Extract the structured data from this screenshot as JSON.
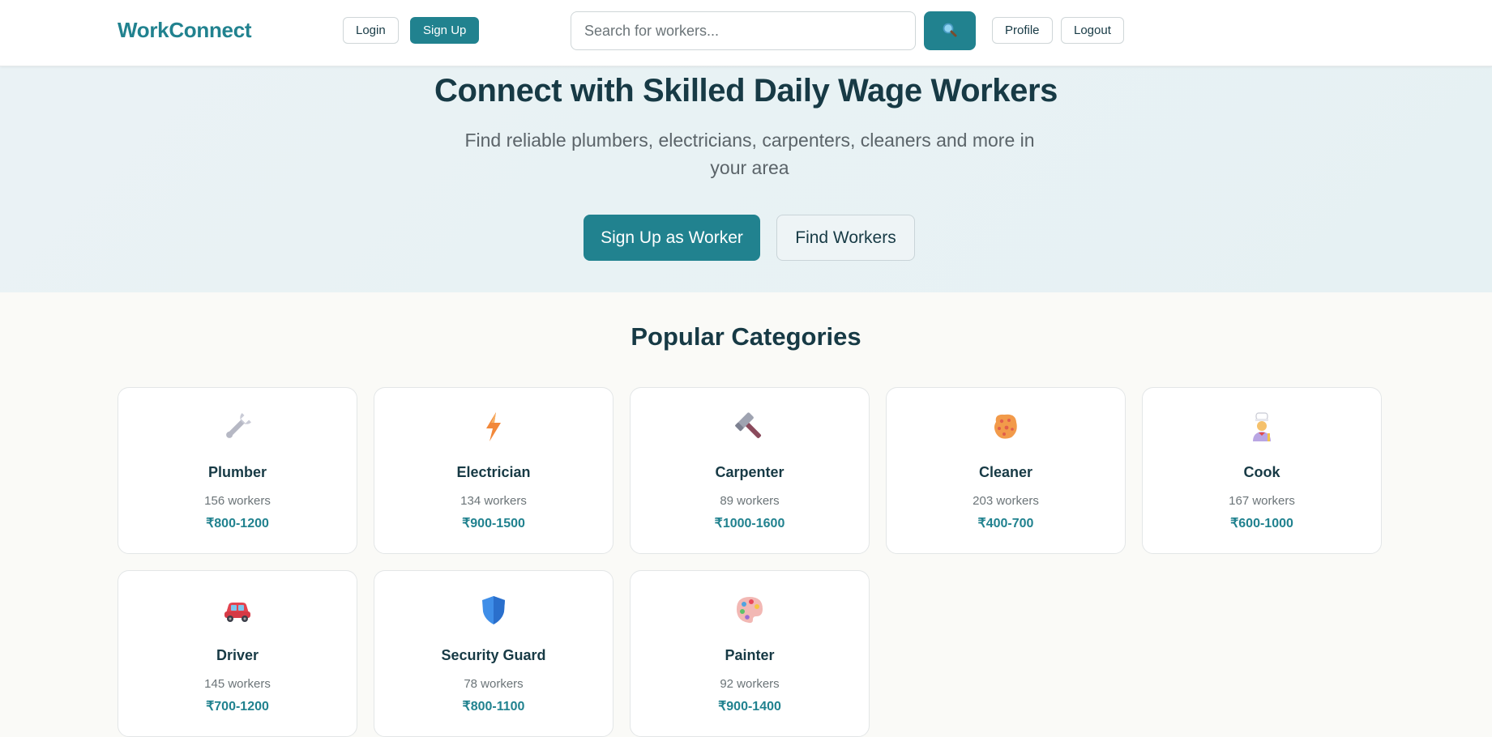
{
  "header": {
    "logo": "WorkConnect",
    "login_label": "Login",
    "signup_label": "Sign Up",
    "search_placeholder": "Search for workers...",
    "search_icon": "magnifier-icon",
    "profile_label": "Profile",
    "logout_label": "Logout"
  },
  "hero": {
    "title": "Connect with Skilled Daily Wage Workers",
    "subtitle": "Find reliable plumbers, electricians, carpenters, cleaners and more in your area",
    "primary_button": "Sign Up as Worker",
    "secondary_button": "Find Workers"
  },
  "categories": {
    "title": "Popular Categories",
    "items": [
      {
        "name": "Plumber",
        "count": "156 workers",
        "rate": "₹800-1200",
        "icon": "wrench-icon"
      },
      {
        "name": "Electrician",
        "count": "134 workers",
        "rate": "₹900-1500",
        "icon": "lightning-icon"
      },
      {
        "name": "Carpenter",
        "count": "89 workers",
        "rate": "₹1000-1600",
        "icon": "hammer-icon"
      },
      {
        "name": "Cleaner",
        "count": "203 workers",
        "rate": "₹400-700",
        "icon": "sponge-icon"
      },
      {
        "name": "Cook",
        "count": "167 workers",
        "rate": "₹600-1000",
        "icon": "cook-icon"
      },
      {
        "name": "Driver",
        "count": "145 workers",
        "rate": "₹700-1200",
        "icon": "car-icon"
      },
      {
        "name": "Security Guard",
        "count": "78 workers",
        "rate": "₹800-1100",
        "icon": "shield-icon"
      },
      {
        "name": "Painter",
        "count": "92 workers",
        "rate": "₹900-1400",
        "icon": "palette-icon"
      }
    ]
  },
  "colors": {
    "brand": "#21828f",
    "text_dark": "#173a45",
    "text_muted": "#6b7478"
  }
}
